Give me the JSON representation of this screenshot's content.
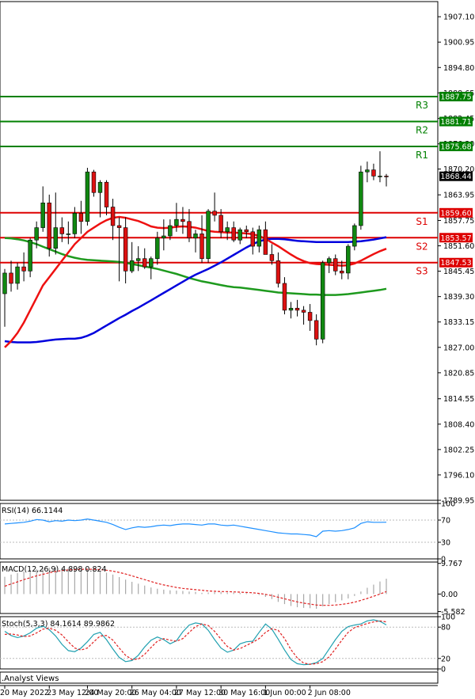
{
  "chart_data": {
    "type": "candlestick",
    "main": {
      "price_ticks": [
        "1907.10",
        "1900.95",
        "1894.80",
        "1888.65",
        "1882.45",
        "1876.30",
        "1870.20",
        "1863.95",
        "1857.75",
        "1851.60",
        "1845.45",
        "1839.30",
        "1833.15",
        "1827.00",
        "1820.85",
        "1814.55",
        "1808.40",
        "1802.25",
        "1796.10",
        "1789.95"
      ],
      "ylim": [
        1789.95,
        1910
      ],
      "levels": [
        {
          "name": "R3",
          "value": 1887.75,
          "label": "1887.75",
          "color": "#008000"
        },
        {
          "name": "R2",
          "value": 1881.71,
          "label": "1881.71",
          "color": "#008000"
        },
        {
          "name": "R1",
          "value": 1875.68,
          "label": "1875.68",
          "color": "#008000"
        },
        {
          "name": "S1",
          "value": 1859.6,
          "label": "1859.60",
          "color": "#dd0000"
        },
        {
          "name": "S2",
          "value": 1853.57,
          "label": "1853.57",
          "color": "#dd0000"
        },
        {
          "name": "S3",
          "value": 1847.53,
          "label": "1847.53",
          "color": "#dd0000"
        }
      ],
      "current_price": {
        "value": 1868.44,
        "label": "1868.44"
      },
      "candles": [
        [
          1840.0,
          1846.0,
          1832.0,
          1845.0
        ],
        [
          1845.0,
          1848.0,
          1840.5,
          1842.5
        ],
        [
          1842.5,
          1847.5,
          1841.0,
          1846.5
        ],
        [
          1846.5,
          1850.0,
          1843.0,
          1845.5
        ],
        [
          1845.5,
          1853.5,
          1844.0,
          1853.0
        ],
        [
          1853.0,
          1857.5,
          1851.0,
          1856.0
        ],
        [
          1856.0,
          1866.0,
          1855.0,
          1862.0
        ],
        [
          1862.0,
          1864.0,
          1849.0,
          1851.0
        ],
        [
          1851.0,
          1864.5,
          1849.5,
          1856.0
        ],
        [
          1856.0,
          1858.5,
          1852.5,
          1854.5
        ],
        [
          1854.5,
          1857.5,
          1852.0,
          1854.5
        ],
        [
          1854.5,
          1861.0,
          1853.5,
          1859.5
        ],
        [
          1859.5,
          1862.5,
          1854.5,
          1857.5
        ],
        [
          1857.5,
          1870.5,
          1856.5,
          1869.5
        ],
        [
          1869.5,
          1870.0,
          1863.5,
          1864.5
        ],
        [
          1864.5,
          1867.5,
          1858.5,
          1867.0
        ],
        [
          1867.0,
          1867.5,
          1859.0,
          1861.0
        ],
        [
          1861.0,
          1863.0,
          1853.0,
          1856.5
        ],
        [
          1856.5,
          1858.5,
          1843.0,
          1856.0
        ],
        [
          1856.0,
          1858.5,
          1842.5,
          1845.5
        ],
        [
          1845.5,
          1852.5,
          1845.0,
          1848.0
        ],
        [
          1848.0,
          1851.5,
          1845.5,
          1848.5
        ],
        [
          1848.5,
          1851.0,
          1846.0,
          1846.5
        ],
        [
          1846.5,
          1849.0,
          1843.5,
          1848.5
        ],
        [
          1848.5,
          1855.0,
          1847.0,
          1853.5
        ],
        [
          1853.5,
          1858.0,
          1850.5,
          1854.0
        ],
        [
          1854.0,
          1858.0,
          1853.0,
          1856.5
        ],
        [
          1856.5,
          1862.0,
          1855.0,
          1858.0
        ],
        [
          1858.0,
          1861.0,
          1854.5,
          1857.5
        ],
        [
          1857.5,
          1860.5,
          1852.5,
          1853.5
        ],
        [
          1853.5,
          1855.5,
          1850.0,
          1854.5
        ],
        [
          1854.5,
          1859.0,
          1847.5,
          1848.5
        ],
        [
          1848.5,
          1860.5,
          1847.5,
          1860.0
        ],
        [
          1860.0,
          1864.5,
          1857.5,
          1859.0
        ],
        [
          1859.0,
          1860.5,
          1853.5,
          1855.0
        ],
        [
          1855.0,
          1857.5,
          1853.0,
          1856.0
        ],
        [
          1856.0,
          1857.5,
          1852.5,
          1853.0
        ],
        [
          1853.0,
          1856.0,
          1852.0,
          1855.5
        ],
        [
          1855.5,
          1856.5,
          1853.5,
          1855.0
        ],
        [
          1855.0,
          1856.0,
          1849.5,
          1851.5
        ],
        [
          1851.5,
          1856.5,
          1850.0,
          1855.5
        ],
        [
          1855.5,
          1857.5,
          1850.0,
          1849.5
        ],
        [
          1849.5,
          1852.0,
          1847.0,
          1848.0
        ],
        [
          1848.0,
          1850.0,
          1841.5,
          1842.5
        ],
        [
          1842.5,
          1844.0,
          1835.0,
          1836.0
        ],
        [
          1836.0,
          1838.0,
          1834.0,
          1836.5
        ],
        [
          1836.5,
          1838.5,
          1834.5,
          1836.0
        ],
        [
          1836.0,
          1837.0,
          1832.5,
          1835.5
        ],
        [
          1835.5,
          1837.5,
          1831.0,
          1833.5
        ],
        [
          1833.5,
          1835.0,
          1827.5,
          1829.0
        ],
        [
          1829.0,
          1848.0,
          1828.0,
          1847.5
        ],
        [
          1847.5,
          1849.0,
          1845.0,
          1848.5
        ],
        [
          1848.5,
          1849.5,
          1844.5,
          1845.5
        ],
        [
          1845.5,
          1848.0,
          1843.5,
          1845.0
        ],
        [
          1845.0,
          1852.0,
          1843.5,
          1851.5
        ],
        [
          1851.5,
          1857.0,
          1850.5,
          1856.5
        ],
        [
          1856.5,
          1871.0,
          1855.5,
          1869.5
        ],
        [
          1869.5,
          1872.0,
          1867.0,
          1870.0
        ],
        [
          1870.0,
          1871.5,
          1867.5,
          1868.5
        ],
        [
          1868.5,
          1874.5,
          1867.0,
          1868.5
        ],
        [
          1868.5,
          1869.0,
          1866.0,
          1868.4
        ]
      ],
      "ma_red": [
        1827,
        1828.5,
        1830.5,
        1833,
        1836,
        1839,
        1842,
        1844,
        1846,
        1848,
        1850,
        1852,
        1853.5,
        1855,
        1856,
        1857,
        1857.8,
        1858.4,
        1858.6,
        1858.4,
        1858.0,
        1857.6,
        1857.0,
        1856.3,
        1856.0,
        1855.9,
        1856.0,
        1856.2,
        1856.3,
        1856.2,
        1856.0,
        1855.6,
        1855.2,
        1855.0,
        1854.9,
        1854.8,
        1854.8,
        1854.7,
        1854.6,
        1854.4,
        1854.0,
        1853.3,
        1852.4,
        1851.5,
        1850.5,
        1849.5,
        1848.6,
        1847.9,
        1847.4,
        1847.2,
        1847.1,
        1847.0,
        1846.9,
        1846.8,
        1846.9,
        1847.3,
        1848.0,
        1848.8,
        1849.6,
        1850.3,
        1850.9
      ],
      "ma_blue": [
        1828.5,
        1828.3,
        1828.2,
        1828.2,
        1828.2,
        1828.3,
        1828.5,
        1828.7,
        1828.9,
        1829.0,
        1829.1,
        1829.1,
        1829.3,
        1829.8,
        1830.5,
        1831.4,
        1832.3,
        1833.2,
        1834.1,
        1834.9,
        1835.8,
        1836.6,
        1837.5,
        1838.4,
        1839.3,
        1840.2,
        1841.1,
        1842.0,
        1842.9,
        1843.8,
        1844.6,
        1845.3,
        1846.0,
        1846.8,
        1847.6,
        1848.5,
        1849.4,
        1850.3,
        1851.2,
        1852.0,
        1852.7,
        1853.1,
        1853.3,
        1853.3,
        1853.2,
        1853.0,
        1852.8,
        1852.7,
        1852.6,
        1852.5,
        1852.5,
        1852.5,
        1852.5,
        1852.5,
        1852.5,
        1852.6,
        1852.7,
        1852.9,
        1853.1,
        1853.4,
        1853.7
      ],
      "ma_green": [
        1853.5,
        1853.4,
        1853.2,
        1852.9,
        1852.5,
        1852.0,
        1851.4,
        1850.8,
        1850.2,
        1849.6,
        1849.1,
        1848.7,
        1848.4,
        1848.2,
        1848.1,
        1848.0,
        1847.9,
        1847.8,
        1847.7,
        1847.5,
        1847.2,
        1846.9,
        1846.6,
        1846.3,
        1846.0,
        1845.6,
        1845.2,
        1844.8,
        1844.3,
        1843.8,
        1843.4,
        1843.0,
        1842.7,
        1842.4,
        1842.1,
        1841.8,
        1841.6,
        1841.5,
        1841.3,
        1841.1,
        1840.9,
        1840.7,
        1840.5,
        1840.3,
        1840.2,
        1840.1,
        1840.0,
        1839.9,
        1839.8,
        1839.8,
        1839.7,
        1839.7,
        1839.7,
        1839.8,
        1839.9,
        1840.1,
        1840.3,
        1840.5,
        1840.7,
        1840.9,
        1841.2
      ]
    },
    "x_labels": [
      {
        "label": "20 May 2022",
        "i": 0
      },
      {
        "label": "23 May 12:00",
        "i": 7
      },
      {
        "label": "24 May 20:00",
        "i": 13
      },
      {
        "label": "26 May 04:00",
        "i": 20
      },
      {
        "label": "27 May 12:00",
        "i": 27
      },
      {
        "label": "30 May 16:00",
        "i": 34
      },
      {
        "label": "1 Jun 00:00",
        "i": 41
      },
      {
        "label": "2 Jun 08:00",
        "i": 48
      }
    ],
    "rsi": {
      "title": "RSI(14) 66.1144",
      "ticks": [
        "100",
        "70",
        "30",
        "0"
      ],
      "ylim": [
        0,
        100
      ],
      "values": [
        63,
        64,
        65,
        66,
        68,
        71,
        70,
        67,
        69,
        68,
        70,
        69,
        70,
        72,
        70,
        68,
        66,
        62,
        57,
        53,
        56,
        58,
        57,
        58,
        60,
        61,
        60,
        62,
        63,
        63,
        62,
        61,
        63,
        63,
        61,
        60,
        61,
        59,
        57,
        55,
        53,
        51,
        49,
        47,
        46,
        45,
        45,
        44,
        43,
        40,
        50,
        51,
        50,
        51,
        53,
        56,
        64,
        67,
        66,
        66,
        66.1
      ]
    },
    "macd": {
      "title": "MACD(12,26,9) 4.898 0.824",
      "ticks": [
        "9.767",
        "0.00",
        "-5.582"
      ],
      "ylim": [
        -6.2,
        10.2
      ],
      "hist": [
        5.5,
        6.2,
        6.7,
        7.2,
        7.6,
        7.9,
        8.3,
        8.4,
        8.5,
        8.4,
        8.3,
        8.1,
        7.8,
        7.8,
        7.6,
        7.3,
        6.8,
        6.2,
        5.4,
        4.6,
        3.9,
        3.3,
        2.7,
        2.1,
        1.7,
        1.4,
        1.2,
        1.1,
        1.0,
        0.8,
        0.7,
        0.4,
        0.5,
        0.6,
        0.6,
        0.5,
        0.5,
        0.4,
        0.3,
        0.1,
        -0.3,
        -0.9,
        -1.6,
        -2.5,
        -3.2,
        -3.8,
        -4.2,
        -4.4,
        -4.5,
        -4.7,
        -3.9,
        -3.2,
        -2.6,
        -2.0,
        -1.4,
        -0.6,
        0.8,
        2.0,
        3.0,
        4.0,
        4.9
      ],
      "signal": [
        2.5,
        3.2,
        3.9,
        4.6,
        5.2,
        5.8,
        6.3,
        6.8,
        7.2,
        7.5,
        7.7,
        7.8,
        7.9,
        7.9,
        7.9,
        7.8,
        7.6,
        7.3,
        6.9,
        6.4,
        5.8,
        5.2,
        4.6,
        4.0,
        3.4,
        2.9,
        2.5,
        2.1,
        1.8,
        1.6,
        1.4,
        1.2,
        1.0,
        0.9,
        0.8,
        0.8,
        0.7,
        0.6,
        0.5,
        0.4,
        0.2,
        -0.1,
        -0.5,
        -1.0,
        -1.5,
        -2.0,
        -2.5,
        -2.9,
        -3.2,
        -3.5,
        -3.6,
        -3.6,
        -3.5,
        -3.3,
        -3.0,
        -2.6,
        -2.0,
        -1.4,
        -0.7,
        0.0,
        0.8
      ]
    },
    "stoch": {
      "title": "Stoch(5,3,3) 84.1614 89.9862",
      "ticks": [
        "100",
        "80",
        "20",
        "0"
      ],
      "ylim": [
        0,
        100
      ],
      "main": [
        72,
        64,
        60,
        63,
        69,
        78,
        82,
        75,
        63,
        47,
        35,
        33,
        40,
        52,
        66,
        70,
        56,
        38,
        22,
        14,
        16,
        26,
        42,
        55,
        61,
        56,
        48,
        54,
        71,
        84,
        88,
        86,
        74,
        56,
        40,
        32,
        36,
        48,
        52,
        53,
        70,
        86,
        76,
        57,
        36,
        18,
        10,
        8,
        9,
        12,
        20,
        38,
        56,
        72,
        81,
        84,
        86,
        92,
        94,
        91,
        84.2
      ],
      "signal": [
        66,
        67,
        65,
        62,
        63,
        69,
        76,
        78,
        74,
        65,
        52,
        40,
        36,
        40,
        52,
        63,
        64,
        55,
        40,
        26,
        18,
        19,
        28,
        41,
        53,
        58,
        55,
        53,
        58,
        70,
        81,
        86,
        83,
        72,
        57,
        43,
        36,
        39,
        45,
        51,
        58,
        70,
        77,
        74,
        58,
        37,
        21,
        11,
        9,
        10,
        14,
        23,
        38,
        55,
        70,
        79,
        83,
        87,
        90,
        92,
        90.0
      ]
    }
  },
  "branding": {
    "label": ".Analyst Views"
  }
}
